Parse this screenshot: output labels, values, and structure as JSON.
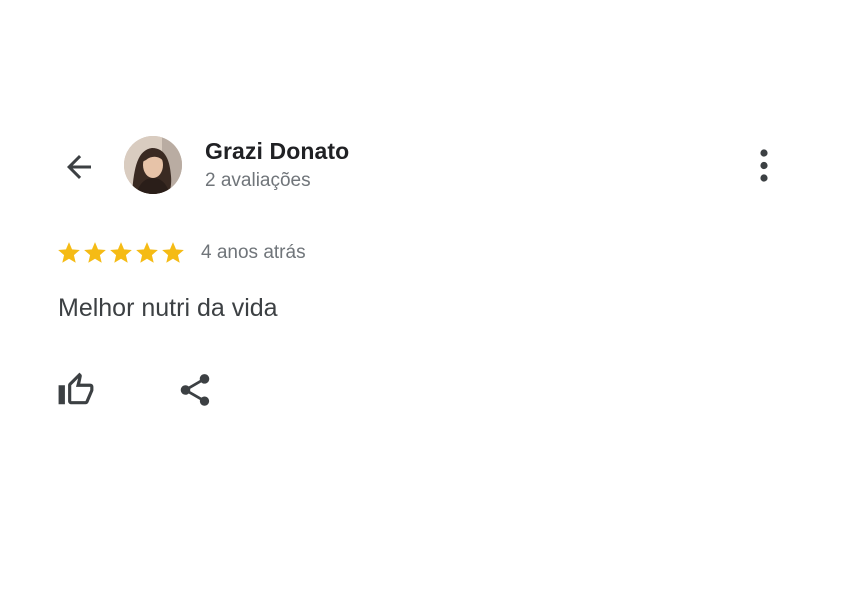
{
  "header": {
    "back_icon": "arrow-back-icon",
    "more_icon": "more-vert-icon"
  },
  "reviewer": {
    "name": "Grazi Donato",
    "reviews_count": "2 avaliações",
    "avatar": "profile-photo"
  },
  "review": {
    "rating": 5,
    "max_rating": 5,
    "star_color": "#f5bb15",
    "time": "4 anos atrás",
    "text": "Melhor nutri da vida"
  },
  "actions": {
    "like_icon": "thumb-up-icon",
    "share_icon": "share-icon"
  }
}
